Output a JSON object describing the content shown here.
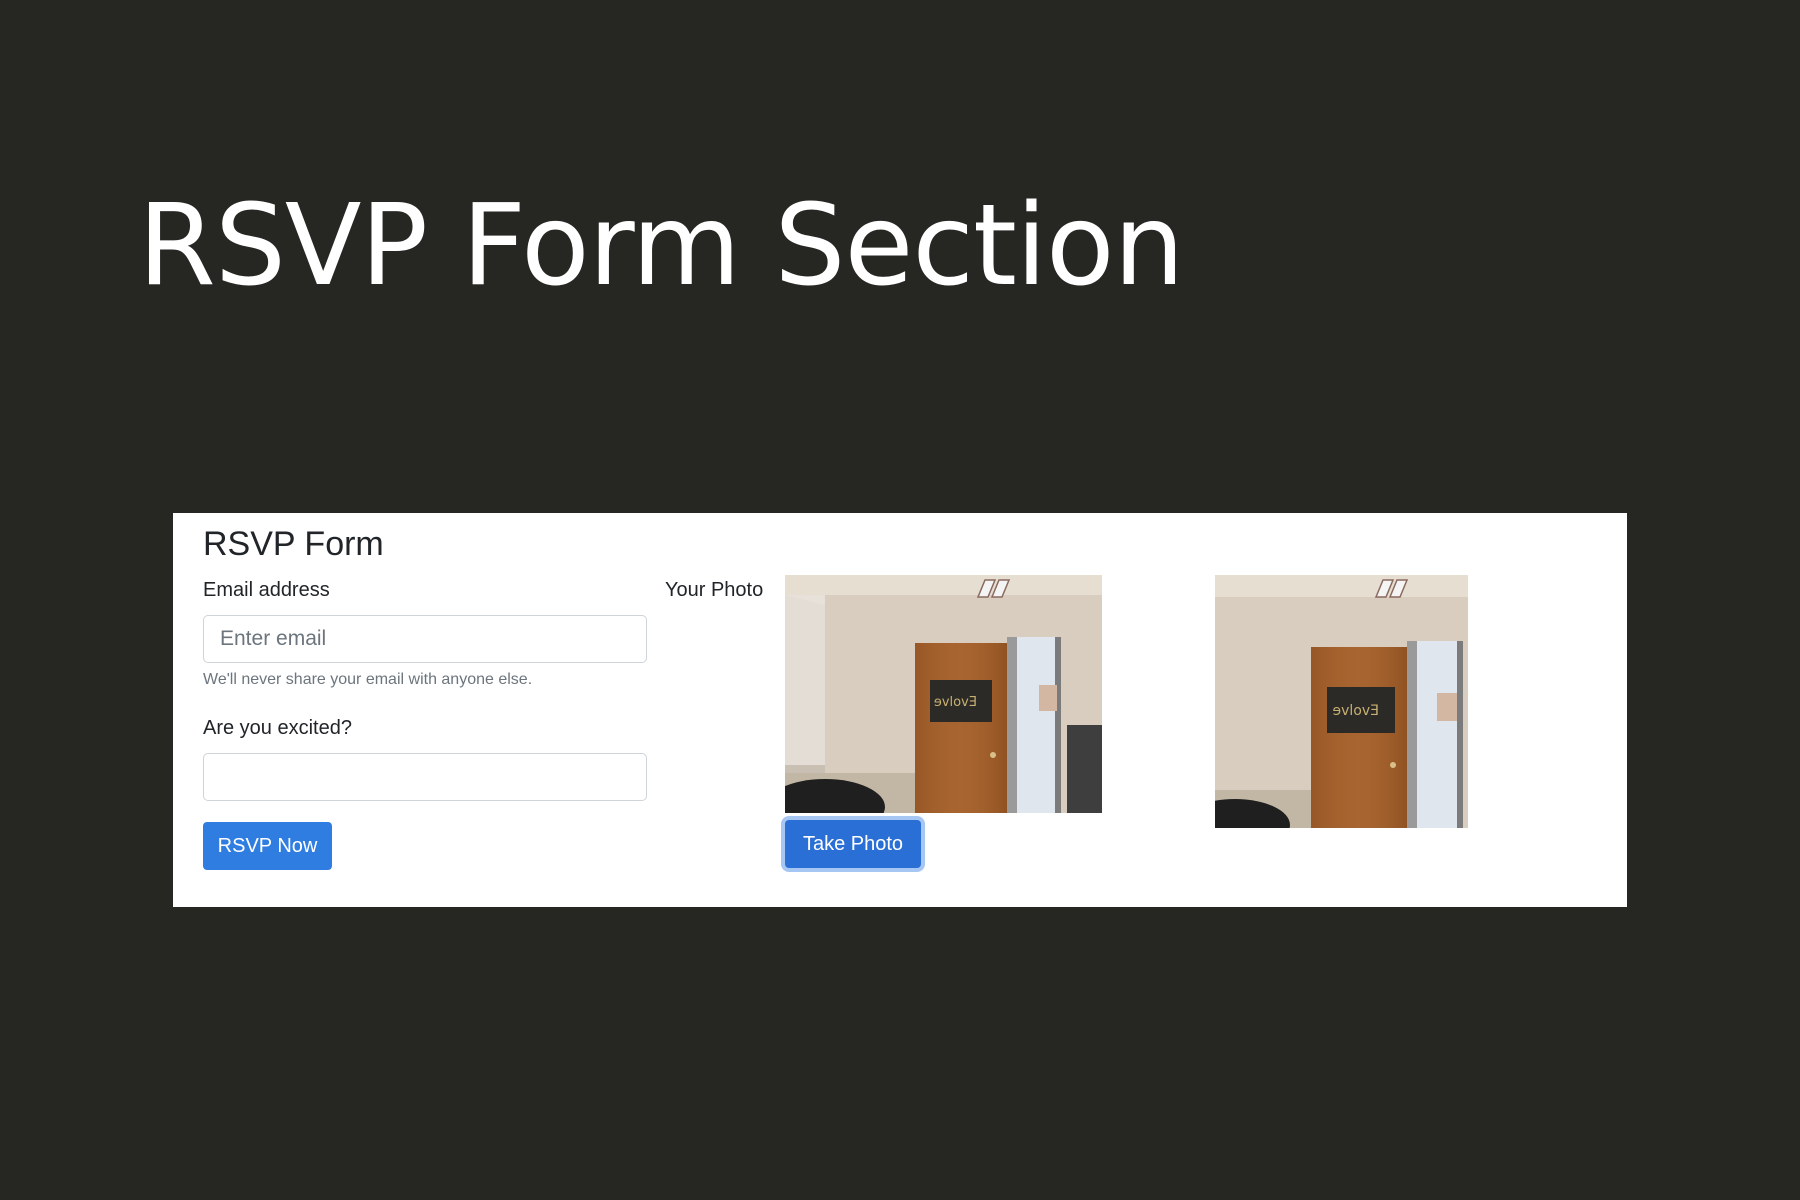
{
  "slide": {
    "title": "RSVP Form Section"
  },
  "form": {
    "heading": "RSVP Form",
    "email_label": "Email address",
    "email_placeholder": "Enter email",
    "email_value": "",
    "email_help": "We'll never share your email with anyone else.",
    "excited_label": "Are you excited?",
    "excited_value": "",
    "submit_label": "RSVP Now"
  },
  "photo": {
    "label": "Your Photo",
    "take_photo_label": "Take Photo",
    "poster_text": "Evolve"
  },
  "colors": {
    "background": "#262723",
    "panel": "#ffffff",
    "primary_button": "#2f7de1",
    "text": "#212529",
    "muted_text": "#6c757d"
  }
}
